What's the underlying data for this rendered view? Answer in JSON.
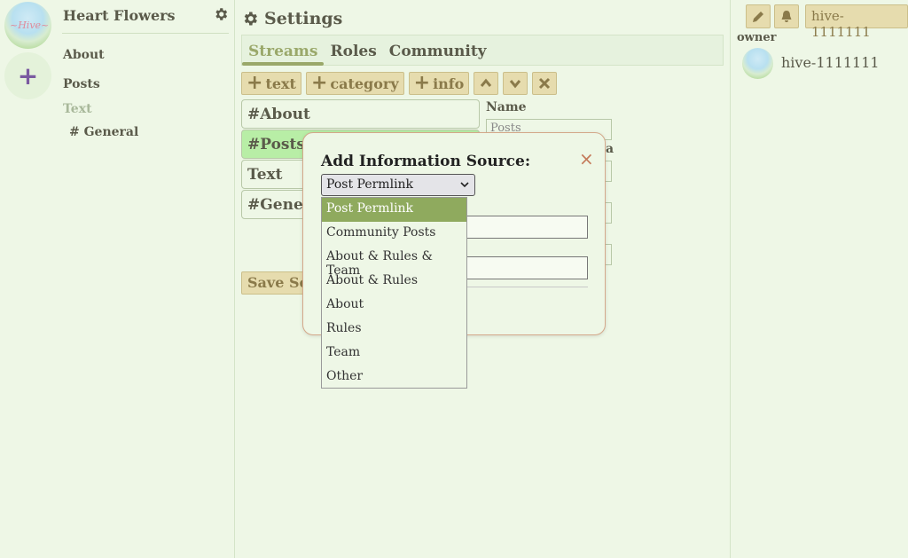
{
  "server": {
    "name": "Heart Flowers",
    "add_label": "+"
  },
  "sidebar": {
    "items": [
      {
        "label": "About"
      },
      {
        "label": "Posts"
      }
    ],
    "category": "Text",
    "sub_items": [
      {
        "label": "# General"
      }
    ]
  },
  "main": {
    "title": "Settings",
    "tabs": [
      {
        "label": "Streams"
      },
      {
        "label": "Roles"
      },
      {
        "label": "Community"
      }
    ],
    "toolbar": {
      "text_label": "text",
      "category_label": "category",
      "info_label": "info"
    },
    "streams": [
      {
        "label": "#About"
      },
      {
        "label": "#Posts"
      },
      {
        "label": "Text"
      },
      {
        "label": "#General"
      }
    ],
    "name_label": "Name",
    "name_value": "Posts",
    "partial_label": "a",
    "save_label": "Save Settings"
  },
  "modal": {
    "title": "Add Information Source:",
    "close": "×",
    "selected": "Post Permlink",
    "options": [
      "Post Permlink",
      "Community Posts",
      "About & Rules & Team",
      "About & Rules",
      "About",
      "Rules",
      "Team",
      "Other"
    ]
  },
  "right": {
    "user_button": "hive-1111111",
    "role": "owner",
    "members": [
      {
        "name": "hive-1111111"
      }
    ]
  },
  "colors": {
    "background": "#eef7e6",
    "accent": "#9aa86a",
    "button": "#e6dcae",
    "selected_stream": "#b8eea6",
    "highlight_option": "#8faa5e"
  }
}
